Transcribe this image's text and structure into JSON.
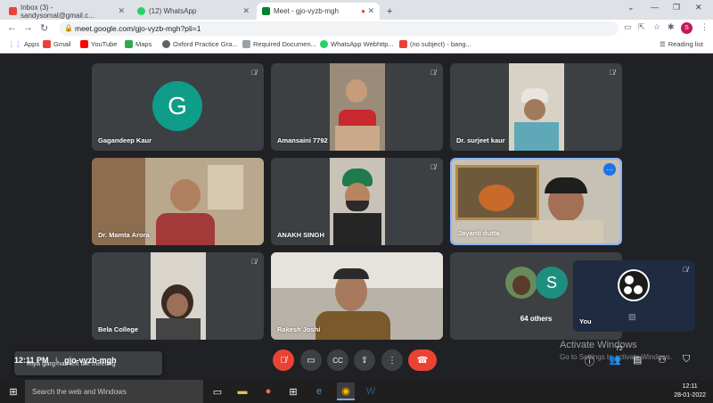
{
  "browser": {
    "tabs": [
      {
        "title": "Inbox (3) - sandysomal@gmail.c...",
        "icon": "gmail-icon"
      },
      {
        "title": "(12) WhatsApp",
        "icon": "whatsapp-icon"
      },
      {
        "title": "Meet - gjo-vyzb-mgh",
        "icon": "meet-icon",
        "recording_dot": "●"
      }
    ],
    "new_tab": "+",
    "url": "meet.google.com/gjo-vyzb-mgh?pli=1",
    "profile_initial": "S",
    "reading_list": "Reading list",
    "bookmarks": [
      "Apps",
      "Gmail",
      "YouTube",
      "Maps",
      "Oxford Practice Gra...",
      "Required Documen...",
      "WhatsApp Webhttp...",
      "(no subject) - bang..."
    ]
  },
  "meet": {
    "tiles": [
      {
        "name": "Gagandeep Kaur",
        "initial": "G",
        "avatar_color": "#0f9d8a"
      },
      {
        "name": "Amansaini 7792"
      },
      {
        "name": "Dr. surjeet kaur"
      },
      {
        "name": "Dr. Mamta Arora"
      },
      {
        "name": "ANAKH SINGH"
      },
      {
        "name": "Jayanti dutta"
      },
      {
        "name": "Bela College"
      },
      {
        "name": "Rakesh Joshi"
      },
      {
        "name": "64 others",
        "initial": "S",
        "avatar_color": "#1e8e7e"
      }
    ],
    "self_tile": {
      "name": "You"
    },
    "toast": "Riya garg has left the meeting",
    "time": "12:11 PM",
    "meeting_code": "gjo-vyzb-mgh",
    "participants_count": "72",
    "activate_title": "Activate Windows",
    "activate_sub": "Go to Settings to activate Windows."
  },
  "taskbar": {
    "search_placeholder": "Search the web and Windows",
    "time": "12:11",
    "date": "28-01-2022"
  },
  "colors": {
    "accent_red": "#ea4335",
    "meet_bg": "#202124",
    "tile_bg": "#3c4043",
    "active_border": "#8ab4f8"
  }
}
